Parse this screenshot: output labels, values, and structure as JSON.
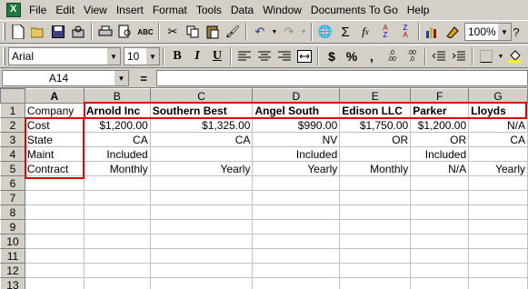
{
  "menu": [
    "File",
    "Edit",
    "View",
    "Insert",
    "Format",
    "Tools",
    "Data",
    "Window",
    "Documents To Go",
    "Help"
  ],
  "toolbar": {
    "zoom": "100%",
    "font": "Arial",
    "size": "10",
    "bold": "B",
    "italic": "I",
    "underline": "U"
  },
  "formula_bar": {
    "name_box": "A14",
    "eq": "=",
    "content": ""
  },
  "columns": [
    "A",
    "B",
    "C",
    "D",
    "E",
    "F",
    "G"
  ],
  "rows": [
    {
      "num": "1",
      "cells": [
        "Company",
        "Arnold Inc",
        "Southern Best",
        "Angel South",
        "Edison LLC",
        "Parker",
        "Lloyds"
      ]
    },
    {
      "num": "2",
      "cells": [
        "Cost",
        "$1,200.00",
        "$1,325.00",
        "$990.00",
        "$1,750.00",
        "$1,200.00",
        "N/A"
      ]
    },
    {
      "num": "3",
      "cells": [
        "State",
        "CA",
        "CA",
        "NV",
        "OR",
        "OR",
        "CA"
      ]
    },
    {
      "num": "4",
      "cells": [
        "Maint",
        "Included",
        "",
        "Included",
        "",
        "Included",
        ""
      ]
    },
    {
      "num": "5",
      "cells": [
        "Contract",
        "Monthly",
        "Yearly",
        "Yearly",
        "Monthly",
        "N/A",
        "Yearly"
      ]
    },
    {
      "num": "6",
      "cells": [
        "",
        "",
        "",
        "",
        "",
        "",
        ""
      ]
    },
    {
      "num": "7",
      "cells": [
        "",
        "",
        "",
        "",
        "",
        "",
        ""
      ]
    },
    {
      "num": "8",
      "cells": [
        "",
        "",
        "",
        "",
        "",
        "",
        ""
      ]
    },
    {
      "num": "9",
      "cells": [
        "",
        "",
        "",
        "",
        "",
        "",
        ""
      ]
    },
    {
      "num": "10",
      "cells": [
        "",
        "",
        "",
        "",
        "",
        "",
        ""
      ]
    },
    {
      "num": "11",
      "cells": [
        "",
        "",
        "",
        "",
        "",
        "",
        ""
      ]
    },
    {
      "num": "12",
      "cells": [
        "",
        "",
        "",
        "",
        "",
        "",
        ""
      ]
    },
    {
      "num": "13",
      "cells": [
        "",
        "",
        "",
        "",
        "",
        "",
        ""
      ]
    }
  ],
  "colors": {
    "highlight": "#e00000",
    "chrome": "#d4d0c8"
  }
}
